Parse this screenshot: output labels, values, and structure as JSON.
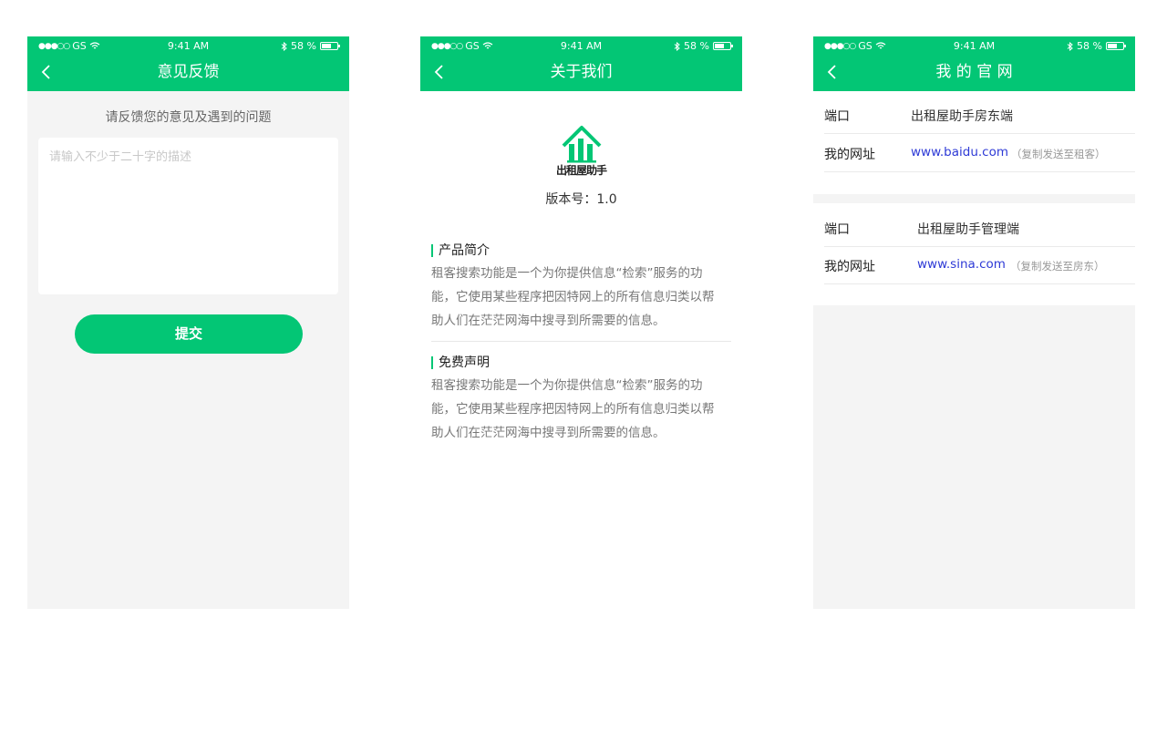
{
  "status_bar": {
    "carrier": "GS",
    "time": "9:41 AM",
    "battery": "58 %"
  },
  "feedback": {
    "title": "意见反馈",
    "prompt": "请反馈您的意见及遇到的问题",
    "placeholder": "请输入不少于二十字的描述",
    "submit_label": "提交"
  },
  "about": {
    "title": "关于我们",
    "logo_text": "出租屋助手",
    "version": "版本号：1.0",
    "sections": [
      {
        "title": "产品简介",
        "body": "租客搜索功能是一个为你提供信息“检索”服务的功能，它使用某些程序把因特网上的所有信息归类以帮助人们在茫茫网海中搜寻到所需要的信息。"
      },
      {
        "title": "免费声明",
        "body": "租客搜索功能是一个为你提供信息“检索”服务的功能，它使用某些程序把因特网上的所有信息归类以帮助人们在茫茫网海中搜寻到所需要的信息。"
      }
    ]
  },
  "website": {
    "title": "我 的 官 网",
    "groups": [
      {
        "port_label": "端口",
        "port_value": "出租屋助手房东端",
        "url_label": "我的网址",
        "url": "www.baidu.com",
        "note": "（复制发送至租客）"
      },
      {
        "port_label": "端口",
        "port_value": "出租屋助手管理端",
        "url_label": "我的网址",
        "url": "www.sina.com",
        "note": "（复制发送至房东）"
      }
    ]
  },
  "colors": {
    "brand_green": "#03c675",
    "link_blue": "#2e3ad6"
  },
  "icons": [
    "back-icon",
    "wifi-icon",
    "bluetooth-icon",
    "battery-icon",
    "house-logo-icon"
  ]
}
